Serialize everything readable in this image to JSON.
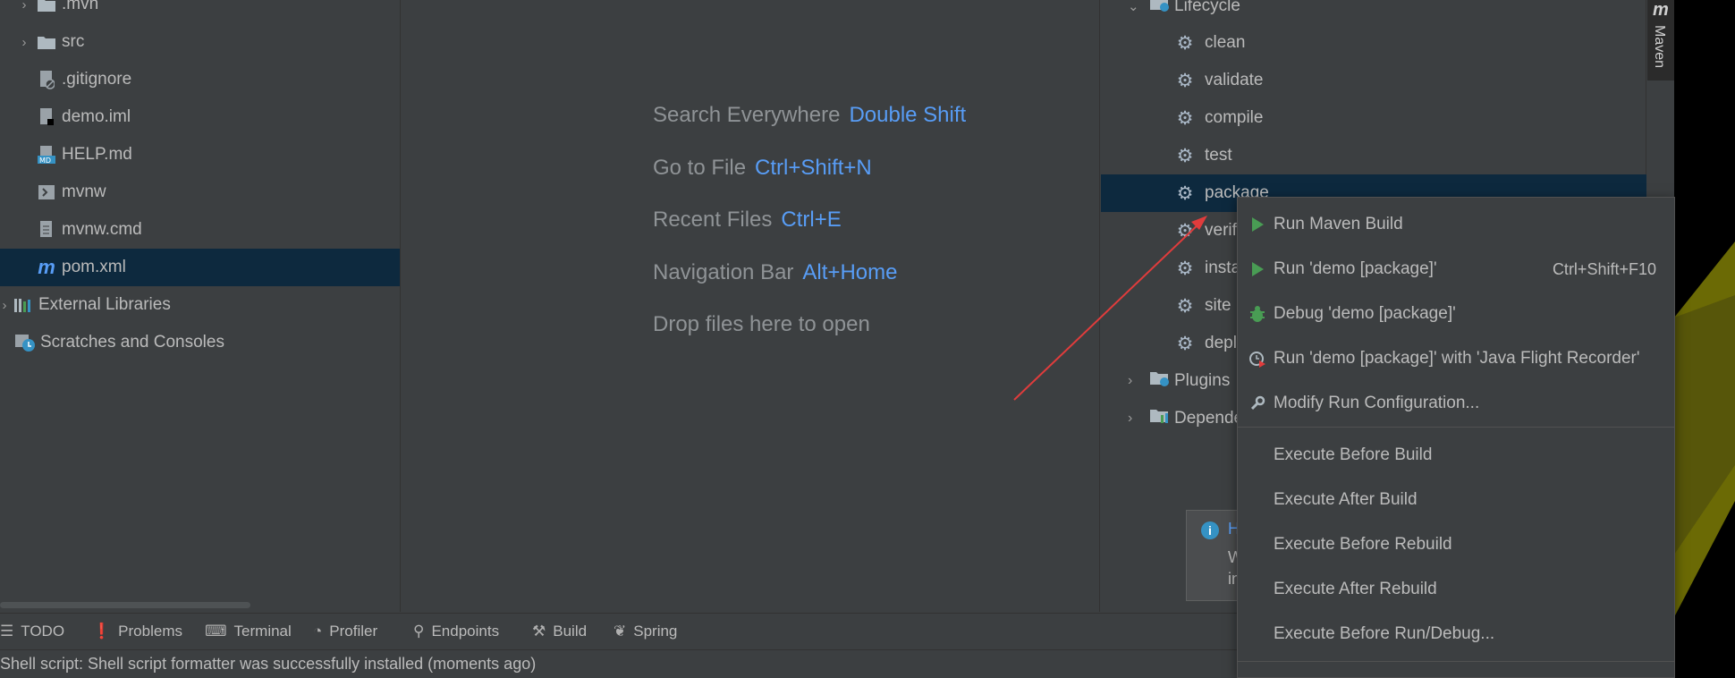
{
  "project": {
    "items": [
      {
        "label": ".mvn",
        "icon": "folder-icon",
        "chevron": "›"
      },
      {
        "label": "src",
        "icon": "folder-icon",
        "chevron": "›"
      },
      {
        "label": ".gitignore",
        "icon": "gitignore-file-icon",
        "chevron": ""
      },
      {
        "label": "demo.iml",
        "icon": "iml-file-icon",
        "chevron": ""
      },
      {
        "label": "HELP.md",
        "icon": "markdown-file-icon",
        "chevron": ""
      },
      {
        "label": "mvnw",
        "icon": "shell-script-icon",
        "chevron": ""
      },
      {
        "label": "mvnw.cmd",
        "icon": "text-file-icon",
        "chevron": ""
      },
      {
        "label": "pom.xml",
        "icon": "maven-pom-icon",
        "chevron": ""
      },
      {
        "label": "External Libraries",
        "icon": "libraries-icon",
        "chevron": "›"
      },
      {
        "label": "Scratches and Consoles",
        "icon": "scratches-icon",
        "chevron": ""
      }
    ]
  },
  "editor": {
    "hints": [
      {
        "label": "Search Everywhere",
        "key": "Double Shift"
      },
      {
        "label": "Go to File",
        "key": "Ctrl+Shift+N"
      },
      {
        "label": "Recent Files",
        "key": "Ctrl+E"
      },
      {
        "label": "Navigation Bar",
        "key": "Alt+Home"
      },
      {
        "label": "Drop files here to open",
        "key": ""
      }
    ]
  },
  "maven": {
    "lifecycle_label": "Lifecycle",
    "goals": [
      "clean",
      "validate",
      "compile",
      "test",
      "package",
      "verify",
      "install",
      "site",
      "deploy"
    ],
    "plugins_label": "Plugins",
    "dependencies_label": "Dependencies",
    "tab_icon_label": "m",
    "tab_label": "Maven"
  },
  "notification": {
    "title": "H",
    "line1": "W",
    "line2": "in"
  },
  "context_menu": {
    "items": [
      {
        "label": "Run Maven Build",
        "shortcut": "",
        "icon": "run-icon"
      },
      {
        "label": "Run 'demo [package]'",
        "shortcut": "Ctrl+Shift+F10",
        "icon": "run-icon"
      },
      {
        "label": "Debug 'demo [package]'",
        "shortcut": "",
        "icon": "debug-icon"
      },
      {
        "label": "Run 'demo [package]' with 'Java Flight Recorder'",
        "shortcut": "",
        "icon": "profiler-run-icon"
      },
      {
        "label": "Modify Run Configuration...",
        "shortcut": "",
        "icon": "wrench-icon"
      }
    ],
    "execute_items": [
      "Execute Before Build",
      "Execute After Build",
      "Execute Before Rebuild",
      "Execute After Rebuild",
      "Execute Before Run/Debug..."
    ]
  },
  "toolbar": {
    "tools": [
      {
        "label": "TODO",
        "icon": "list-icon"
      },
      {
        "label": "Problems",
        "icon": "problems-icon"
      },
      {
        "label": "Terminal",
        "icon": "terminal-icon"
      },
      {
        "label": "Profiler",
        "icon": "profiler-icon"
      },
      {
        "label": "Endpoints",
        "icon": "endpoints-icon"
      },
      {
        "label": "Build",
        "icon": "hammer-icon"
      },
      {
        "label": "Spring",
        "icon": "spring-leaf-icon"
      }
    ]
  },
  "status": {
    "message": "Shell script: Shell script formatter was successfully installed (moments ago)"
  },
  "colors": {
    "background": "#3c3f41",
    "selection": "#0d293e",
    "shortcut_blue": "#589df6",
    "run_green": "#499c54",
    "annotation_red": "#e03c3c",
    "desktop_olive": "#6b6a05"
  }
}
